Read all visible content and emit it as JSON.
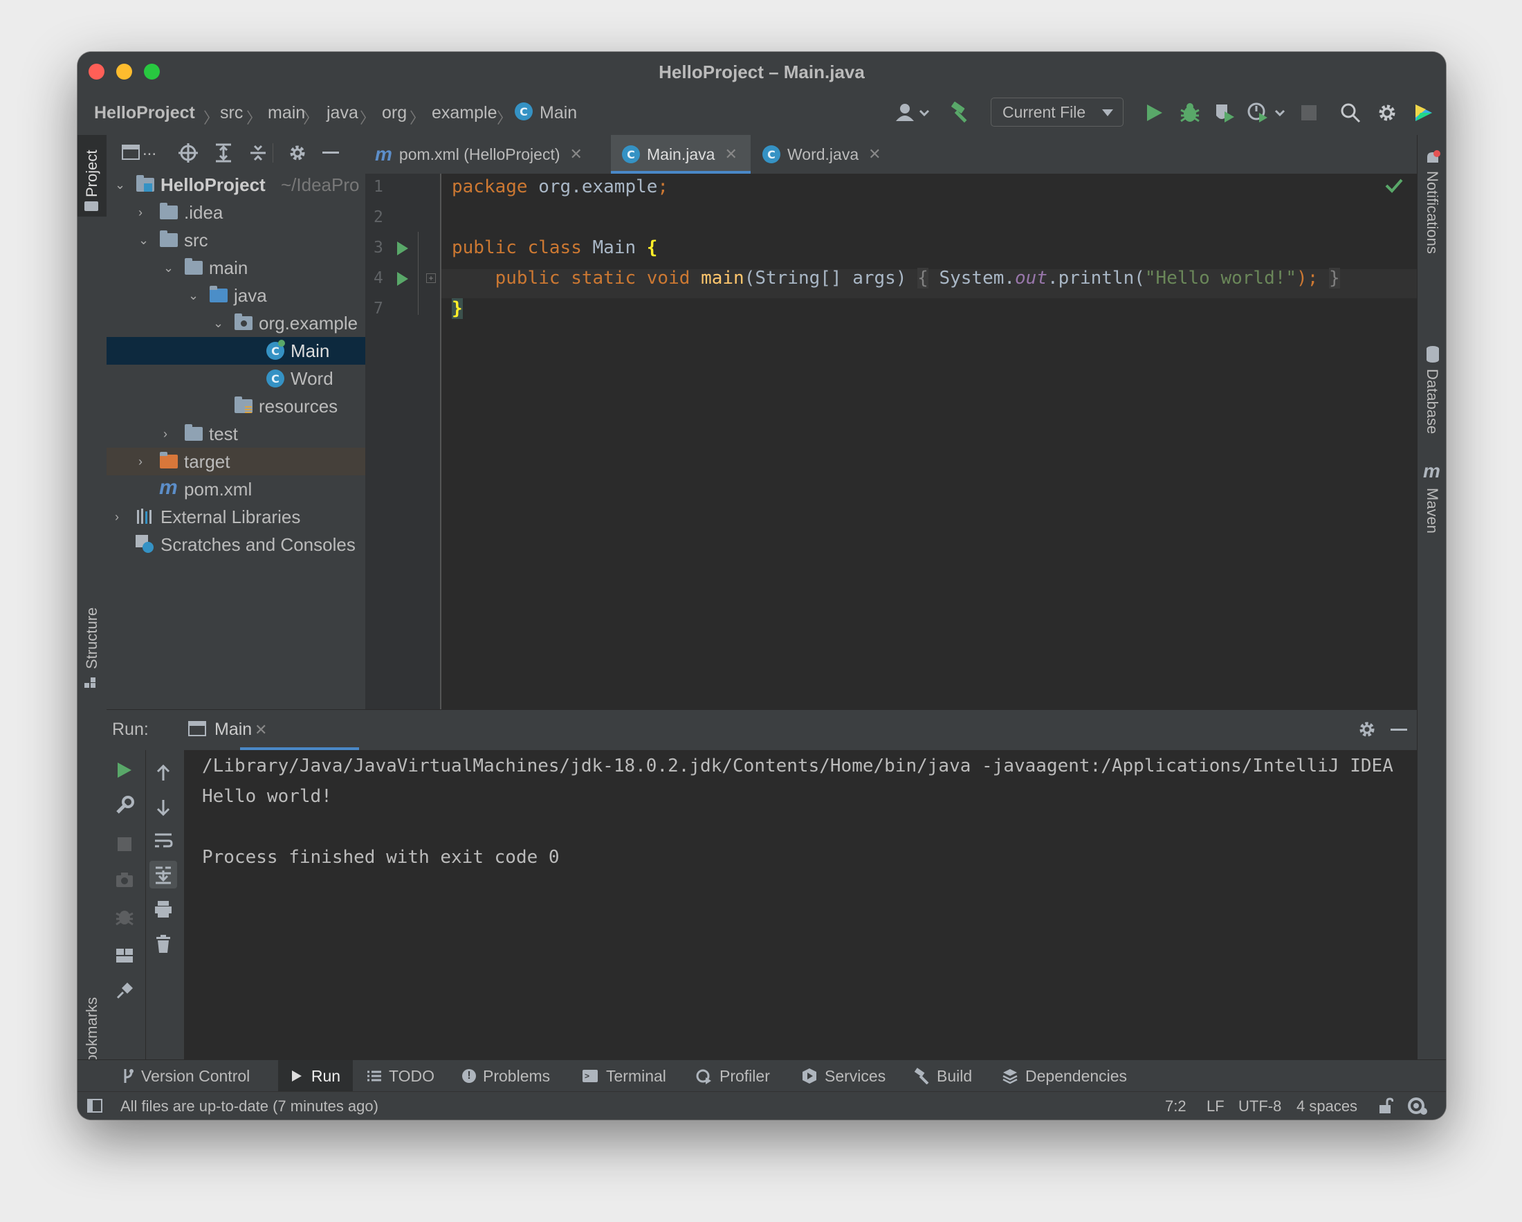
{
  "window": {
    "title": "HelloProject – Main.java",
    "traffic_colors": {
      "close": "#ff5f57",
      "minimize": "#febc2e",
      "zoom": "#28c840"
    }
  },
  "navbar": {
    "breadcrumbs": [
      "HelloProject",
      "src",
      "main",
      "java",
      "org",
      "example",
      "Main"
    ],
    "run_config": "Current File",
    "icons": [
      "user-icon",
      "hammer-icon",
      "run-icon",
      "debug-icon",
      "coverage-icon",
      "profiler-icon",
      "stop-icon",
      "search-icon",
      "gear-icon",
      "jetbrains-icon"
    ]
  },
  "left_strip": {
    "project": "Project",
    "structure": "Structure",
    "bookmarks": "Bookmarks"
  },
  "right_strip": {
    "notifications": "Notifications",
    "database": "Database",
    "maven": "Maven"
  },
  "project_tree": {
    "toolbar_more": "...",
    "root": {
      "label": "HelloProject",
      "path": "~/IdeaPro"
    },
    "items": [
      {
        "label": ".idea"
      },
      {
        "label": "src"
      },
      {
        "label": "main"
      },
      {
        "label": "java"
      },
      {
        "label": "org.example"
      },
      {
        "label": "Main"
      },
      {
        "label": "Word"
      },
      {
        "label": "resources"
      },
      {
        "label": "test"
      },
      {
        "label": "target"
      },
      {
        "label": "pom.xml"
      },
      {
        "label": "External Libraries"
      },
      {
        "label": "Scratches and Consoles"
      }
    ]
  },
  "tabs": [
    {
      "label": "pom.xml (HelloProject)",
      "icon": "m"
    },
    {
      "label": "Main.java",
      "icon": "C"
    },
    {
      "label": "Word.java",
      "icon": "C"
    }
  ],
  "editor": {
    "line_numbers": [
      "1",
      "2",
      "3",
      "4",
      "7"
    ],
    "line1": {
      "kw": "package",
      "rest": " org.example",
      "semi": ";"
    },
    "line3": {
      "kw1": "public",
      "kw2": "class",
      "name": " Main ",
      "brace": "{"
    },
    "line4": {
      "kw1": "public",
      "kw2": "static",
      "kw3": "void",
      "fn": "main",
      "params": "(String[] args) ",
      "open": "{",
      "sys": " System.",
      "out": "out",
      "println": ".println(",
      "str": "\"Hello world!\"",
      "end": ");",
      "close": "}"
    },
    "line7": {
      "brace": "}"
    }
  },
  "run_panel": {
    "label": "Run:",
    "tab": "Main",
    "console": [
      "/Library/Java/JavaVirtualMachines/jdk-18.0.2.jdk/Contents/Home/bin/java -javaagent:/Applications/IntelliJ IDEA",
      "Hello world!",
      "",
      "Process finished with exit code 0"
    ]
  },
  "bottom_tools": [
    {
      "label": "Version Control"
    },
    {
      "label": "Run"
    },
    {
      "label": "TODO"
    },
    {
      "label": "Problems"
    },
    {
      "label": "Terminal"
    },
    {
      "label": "Profiler"
    },
    {
      "label": "Services"
    },
    {
      "label": "Build"
    },
    {
      "label": "Dependencies"
    }
  ],
  "status": {
    "message": "All files are up-to-date (7 minutes ago)",
    "position": "7:2",
    "line_sep": "LF",
    "encoding": "UTF-8",
    "indent": "4 spaces"
  }
}
